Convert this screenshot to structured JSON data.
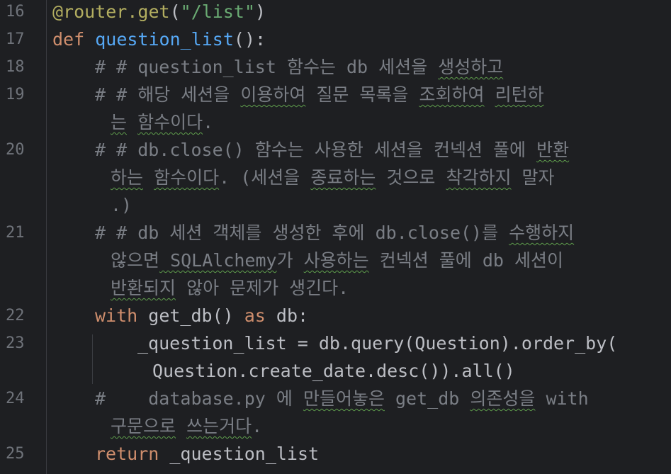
{
  "colors": {
    "background": "#1e1f22",
    "line_number": "#6f737a",
    "default_text": "#bcbec4",
    "keyword": "#cf8e6d",
    "function_name": "#56a8f5",
    "string": "#6aab73",
    "decorator": "#b3ae60",
    "comment": "#7a7e85",
    "spellcheck_underline": "#5f9e4c"
  },
  "line_numbers": [
    "16",
    "17",
    "18",
    "19",
    "20",
    "21",
    "22",
    "23",
    "24",
    "25"
  ],
  "code": {
    "l16": {
      "decorator": "@router.get",
      "open": "(",
      "path": "\"/list\"",
      "close": ")"
    },
    "l17": {
      "def_kw": "def",
      "func_name": "question_list",
      "signature": "():"
    },
    "c18": {
      "a": "# # question_list ",
      "b": "함수는",
      "c": " db 세션을 ",
      "d": "생성하고"
    },
    "c19": {
      "r1a": "# # 해당 세션을 ",
      "r1b": "이용하여",
      "r1c": " 질문 목록을 ",
      "r1d": "조회하여",
      "r1e": " ",
      "r1f": "리턴하",
      "r2a": "는",
      "r2b": " ",
      "r2c": "함수이다",
      "r2d": "."
    },
    "c20": {
      "r1a": "# # db.close() ",
      "r1b": "함수는",
      "r1c": " ",
      "r1d": "사용한",
      "r1e": " 세션을 컨넥션 풀에 ",
      "r1f": "반환",
      "r2a": "하는",
      "r2b": " ",
      "r2c": "함수이다",
      "r2d": ". (세션을 ",
      "r2e": "종료하는",
      "r2f": " 것으로 ",
      "r2g": "착각하지",
      "r2h": " 말자",
      "r3": ".)"
    },
    "c21": {
      "r1a": "# # db 세션 객체를 ",
      "r1b": "생성한",
      "r1c": " 후에 db.close()를 ",
      "r1d": "수행하지",
      "r2a": "않으면",
      "r2b": " SQLAlchemy",
      "r2c": "가",
      "r2d": " ",
      "r2e": "사용하는",
      "r2f": " 컨넥션 풀에 db 세션이",
      "r3a": "반환되지",
      "r3b": " 않아 문제가 생긴다."
    },
    "l22": {
      "with_kw": "with",
      "call": " get_db() ",
      "as_kw": "as",
      "target": " db:"
    },
    "l23": {
      "r1": "_question_list = db.query(Question).order_by(",
      "r2": "Question.create_date.desc()).all()"
    },
    "c24": {
      "r1a": "#    database.py 에 ",
      "r1b": "만들어놓은",
      "r1c": " get_db ",
      "r1d": "의존성을",
      "r1e": " with",
      "r2a": "구문으로",
      "r2b": " ",
      "r2c": "쓰는거다",
      "r2d": "."
    },
    "l25": {
      "return_kw": "return",
      "value": " _question_list"
    }
  }
}
